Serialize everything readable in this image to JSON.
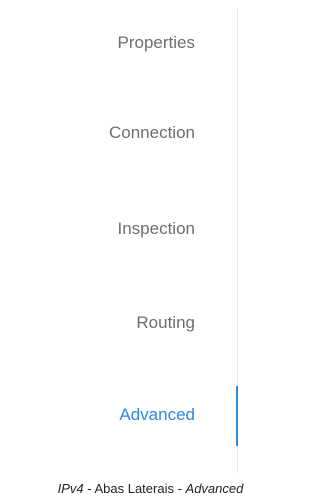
{
  "sidebar": {
    "tabs": [
      {
        "label": "Properties"
      },
      {
        "label": "Connection"
      },
      {
        "label": "Inspection"
      },
      {
        "label": "Routing"
      },
      {
        "label": "Advanced",
        "active": true
      }
    ]
  },
  "colors": {
    "active_tab": "#2b8ae0",
    "inactive_tab": "#6a6e73",
    "divider": "#e4e6e8"
  },
  "caption": {
    "part1": "IPv4",
    "sep1": " - Abas Laterais - ",
    "part2": "Advanced"
  }
}
